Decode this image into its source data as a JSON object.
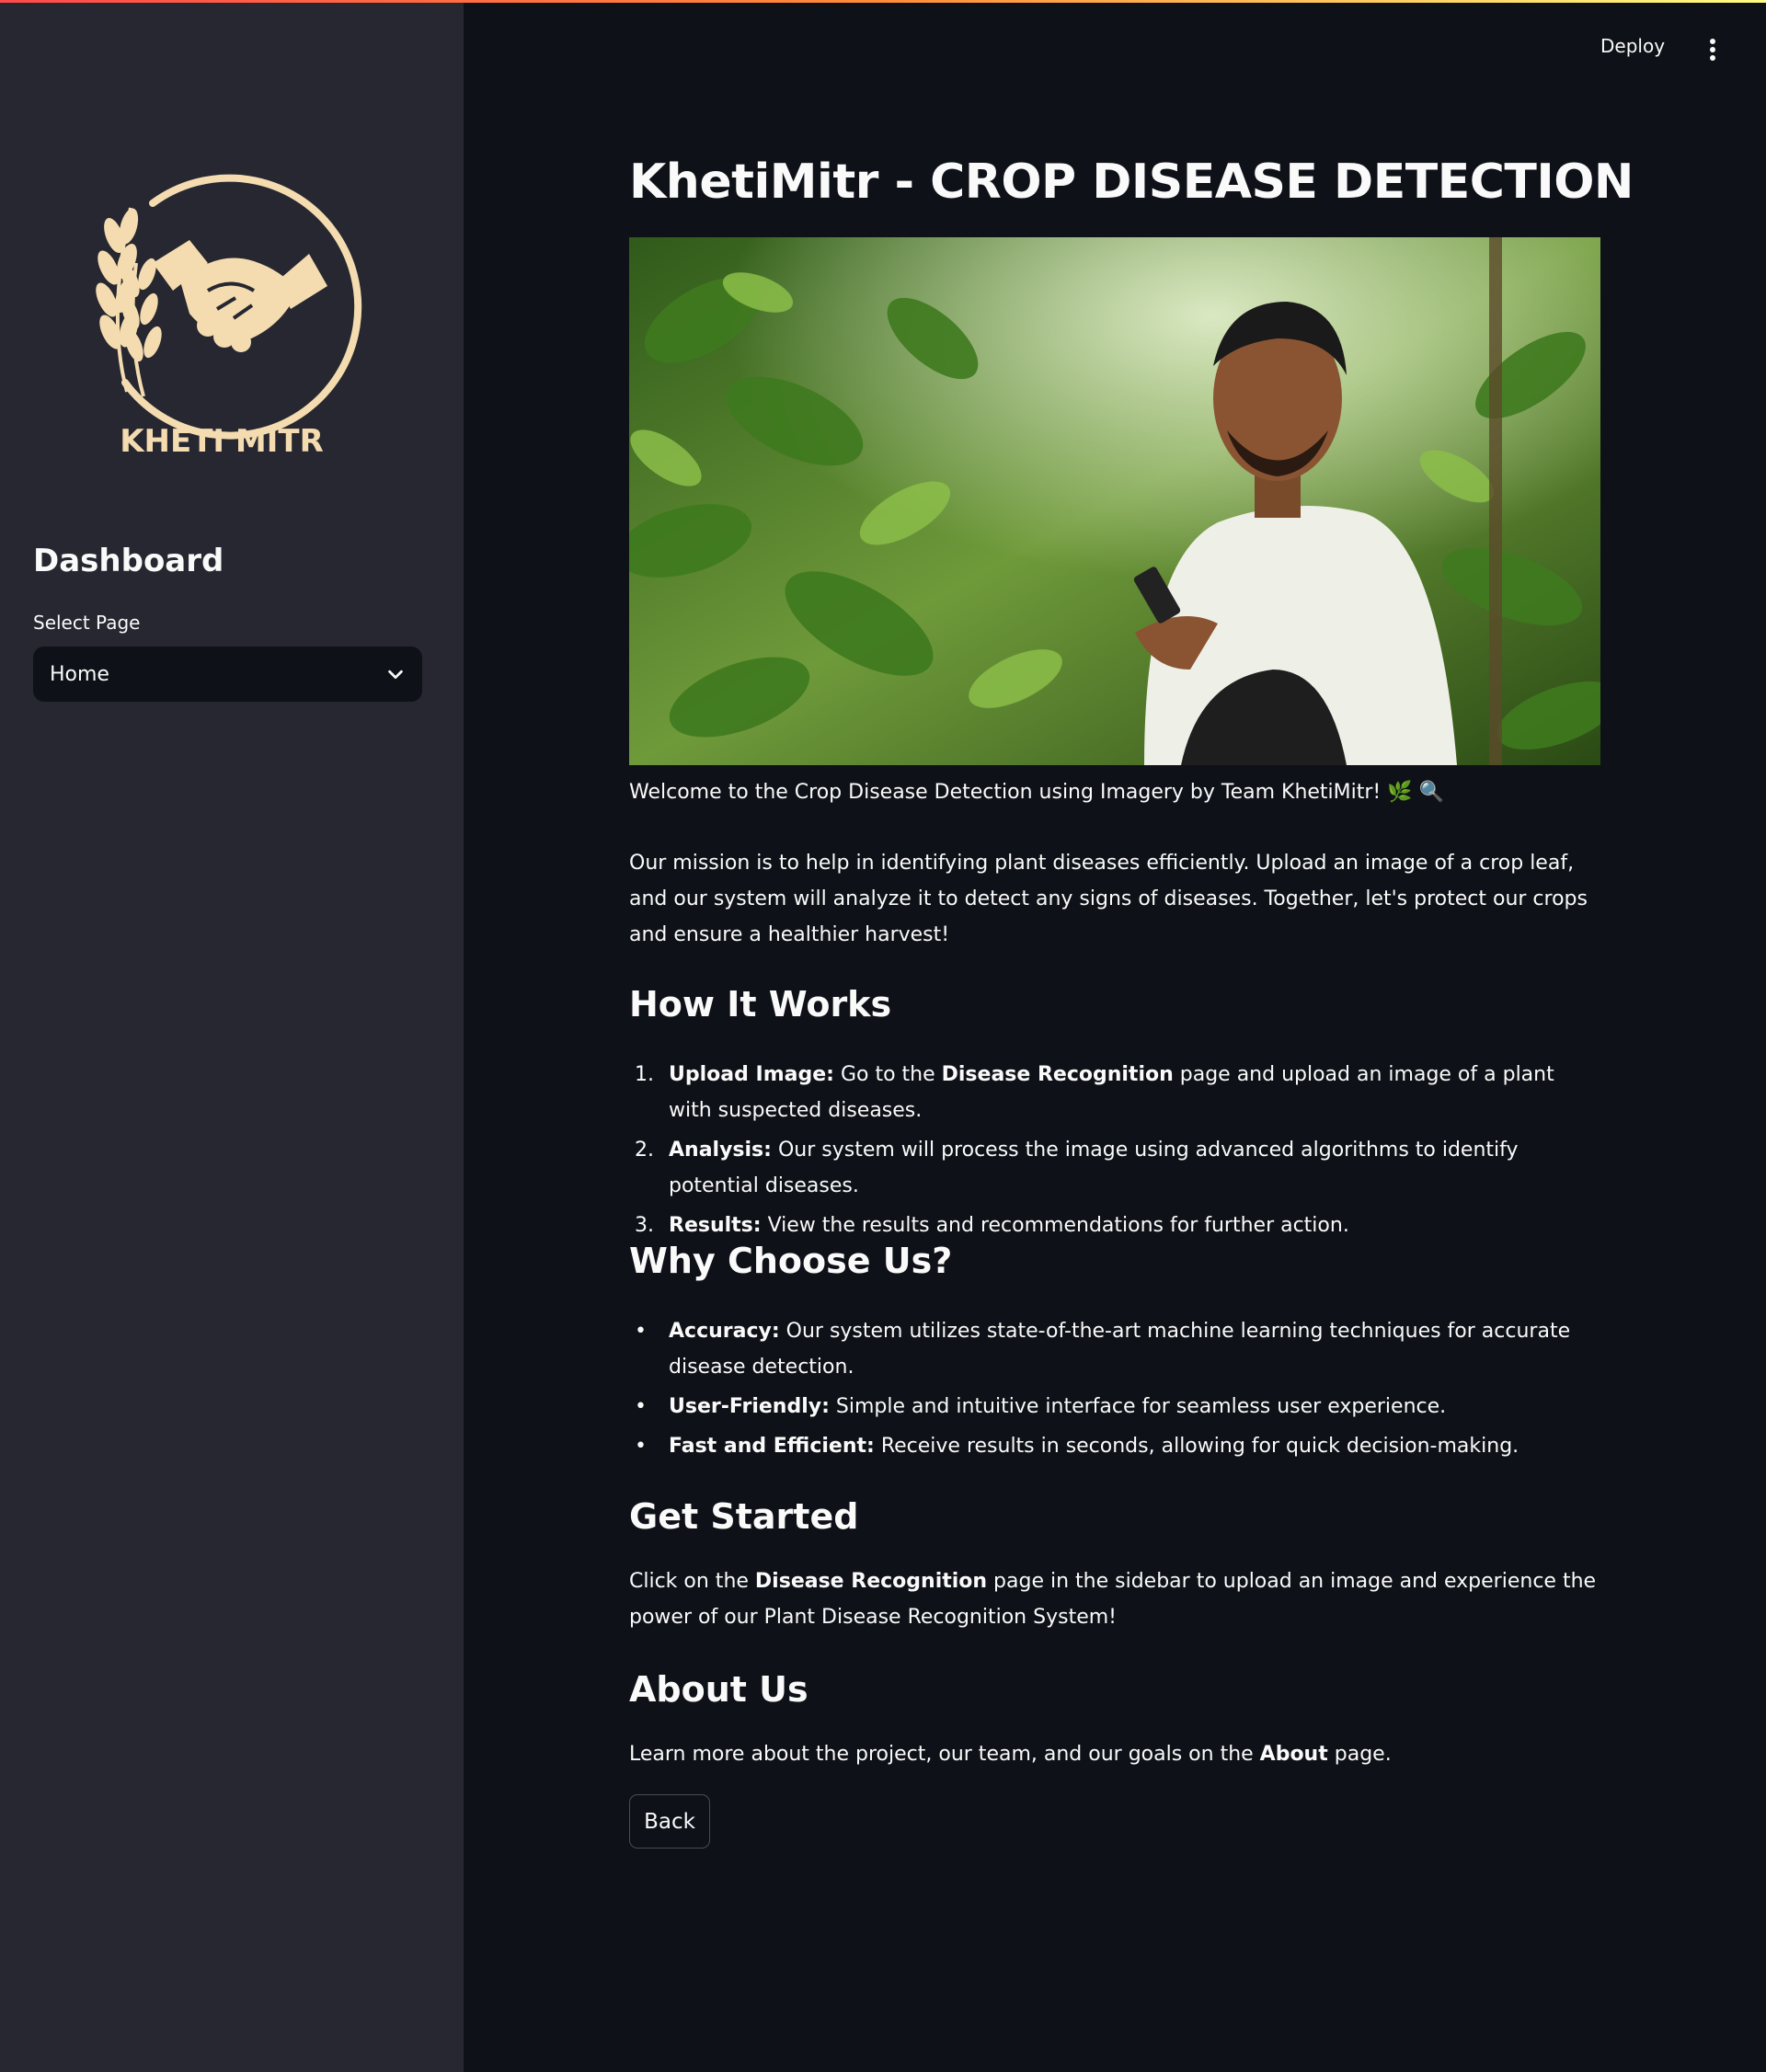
{
  "sidebar": {
    "logo_text": "KHETI MITR",
    "heading": "Dashboard",
    "select_label": "Select Page",
    "select_value": "Home"
  },
  "header": {
    "deploy_label": "Deploy"
  },
  "main": {
    "title": "KhetiMitr - CROP DISEASE DETECTION",
    "welcome": "Welcome to the Crop Disease Detection using Imagery by Team KhetiMitr!",
    "welcome_emoji": "🌿 🔍",
    "mission": "Our mission is to help in identifying plant diseases efficiently. Upload an image of a crop leaf, and our system will analyze it to detect any signs of diseases. Together, let's protect our crops and ensure a healthier harvest!",
    "how_heading": "How It Works",
    "how_steps": [
      {
        "num": "1.",
        "bold": "Upload Image:",
        "pre": " Go to the ",
        "bold2": "Disease Recognition",
        "text": " page and upload an image of a plant with suspected diseases."
      },
      {
        "num": "2.",
        "bold": "Analysis:",
        "text": " Our system will process the image using advanced algorithms to identify potential diseases."
      },
      {
        "num": "3.",
        "bold": "Results:",
        "text": " View the results and recommendations for further action."
      }
    ],
    "why_heading": "Why Choose Us?",
    "why_items": [
      {
        "bold": "Accuracy:",
        "text": " Our system utilizes state-of-the-art machine learning techniques for accurate disease detection."
      },
      {
        "bold": "User-Friendly:",
        "text": " Simple and intuitive interface for seamless user experience."
      },
      {
        "bold": "Fast and Efficient:",
        "text": " Receive results in seconds, allowing for quick decision-making."
      }
    ],
    "bullet": "•",
    "started_heading": "Get Started",
    "started_pre": "Click on the ",
    "started_bold": "Disease Recognition",
    "started_post": " page in the sidebar to upload an image and experience the power of our Plant Disease Recognition System!",
    "about_heading": "About Us",
    "about_pre": "Learn more about the project, our team, and our goals on the ",
    "about_bold": "About",
    "about_post": " page.",
    "back_label": "Back"
  },
  "colors": {
    "background": "#0e1117",
    "sidebar": "#262730",
    "logo": "#f4dcb0",
    "accent_gradient": [
      "#ff4b4b",
      "#fffd80"
    ]
  }
}
